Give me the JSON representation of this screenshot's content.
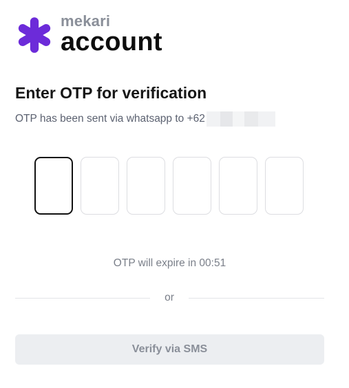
{
  "brand": {
    "name": "mekari",
    "product": "account",
    "logo_icon": "mekari-asterisk-logo-icon",
    "accent_color": "#6C2BD9"
  },
  "heading": {
    "title": "Enter OTP for verification",
    "subtitle": "OTP has been sent via whatsapp to +62"
  },
  "otp": {
    "digits": [
      "",
      "",
      "",
      "",
      "",
      ""
    ]
  },
  "timer": {
    "text": "OTP will expire in 00:51"
  },
  "divider": {
    "label": "or"
  },
  "actions": {
    "sms_label": "Verify via SMS"
  }
}
